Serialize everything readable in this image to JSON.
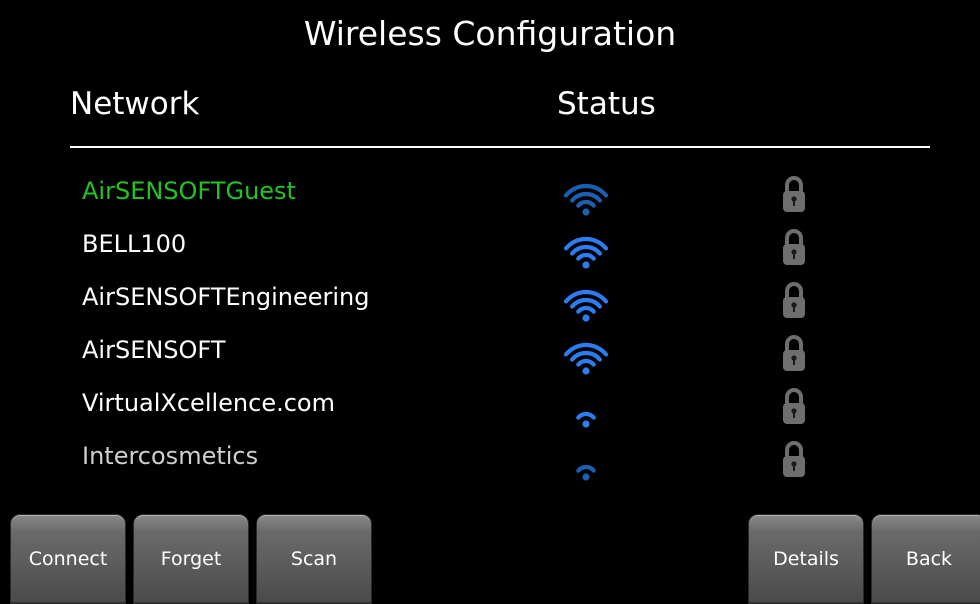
{
  "title": "Wireless Configuration",
  "headers": {
    "network": "Network",
    "status": "Status"
  },
  "networks": [
    {
      "name": "AirSENSOFTGuest",
      "signal_bars": 4,
      "signal_color": "#1b5fb0",
      "secured": true,
      "selected": true
    },
    {
      "name": "BELL100",
      "signal_bars": 4,
      "signal_color": "#2c7df2",
      "secured": true,
      "selected": false
    },
    {
      "name": "AirSENSOFTEngineering",
      "signal_bars": 4,
      "signal_color": "#2c7df2",
      "secured": true,
      "selected": false
    },
    {
      "name": "AirSENSOFT",
      "signal_bars": 4,
      "signal_color": "#2c7df2",
      "secured": true,
      "selected": false
    },
    {
      "name": "VirtualXcellence.com",
      "signal_bars": 2,
      "signal_color": "#2c7df2",
      "secured": true,
      "selected": false
    },
    {
      "name": "Intercosmetics",
      "signal_bars": 2,
      "signal_color": "#1b5fb0",
      "secured": true,
      "selected": false
    }
  ],
  "colors": {
    "selected_text": "#22c322",
    "normal_text": "#ffffff",
    "dim_text": "#cfcfcf",
    "lock": "#6e6e6e"
  },
  "buttons": {
    "connect": "Connect",
    "forget": "Forget",
    "scan": "Scan",
    "details": "Details",
    "back": "Back"
  }
}
